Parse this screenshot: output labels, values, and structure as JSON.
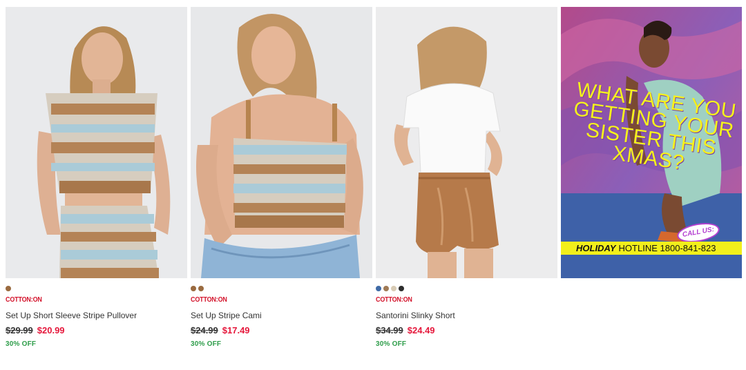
{
  "products": [
    {
      "brand": "COTTON:ON",
      "name": "Set Up Short Sleeve Stripe Pullover",
      "old_price": "$29.99",
      "new_price": "$20.99",
      "discount": "30% OFF",
      "swatches": [
        "#9a6a3f"
      ]
    },
    {
      "brand": "COTTON:ON",
      "name": "Set Up Stripe Cami",
      "old_price": "$24.99",
      "new_price": "$17.49",
      "discount": "30% OFF",
      "swatches": [
        "#9a6a3f",
        "#9a6a3f"
      ]
    },
    {
      "brand": "COTTON:ON",
      "name": "Santorini Slinky Short",
      "old_price": "$34.99",
      "new_price": "$24.49",
      "discount": "30% OFF",
      "swatches": [
        "#3f6aa6",
        "#a07a55",
        "#d8cbb4",
        "#2c2c2c"
      ]
    }
  ],
  "promo": {
    "headline": "WHAT ARE YOU GETTING YOUR SISTER THIS XMAS?",
    "call_us": "CALL US:",
    "hotline_label": "HOLIDAY",
    "hotline_text": "HOTLINE 1800-841-823"
  },
  "colors": {
    "brand_red": "#d3122a",
    "sale_red": "#e5173b",
    "discount_green": "#2e9d4a",
    "promo_yellow": "#f2ef1b",
    "promo_purple": "#b33fd0"
  }
}
